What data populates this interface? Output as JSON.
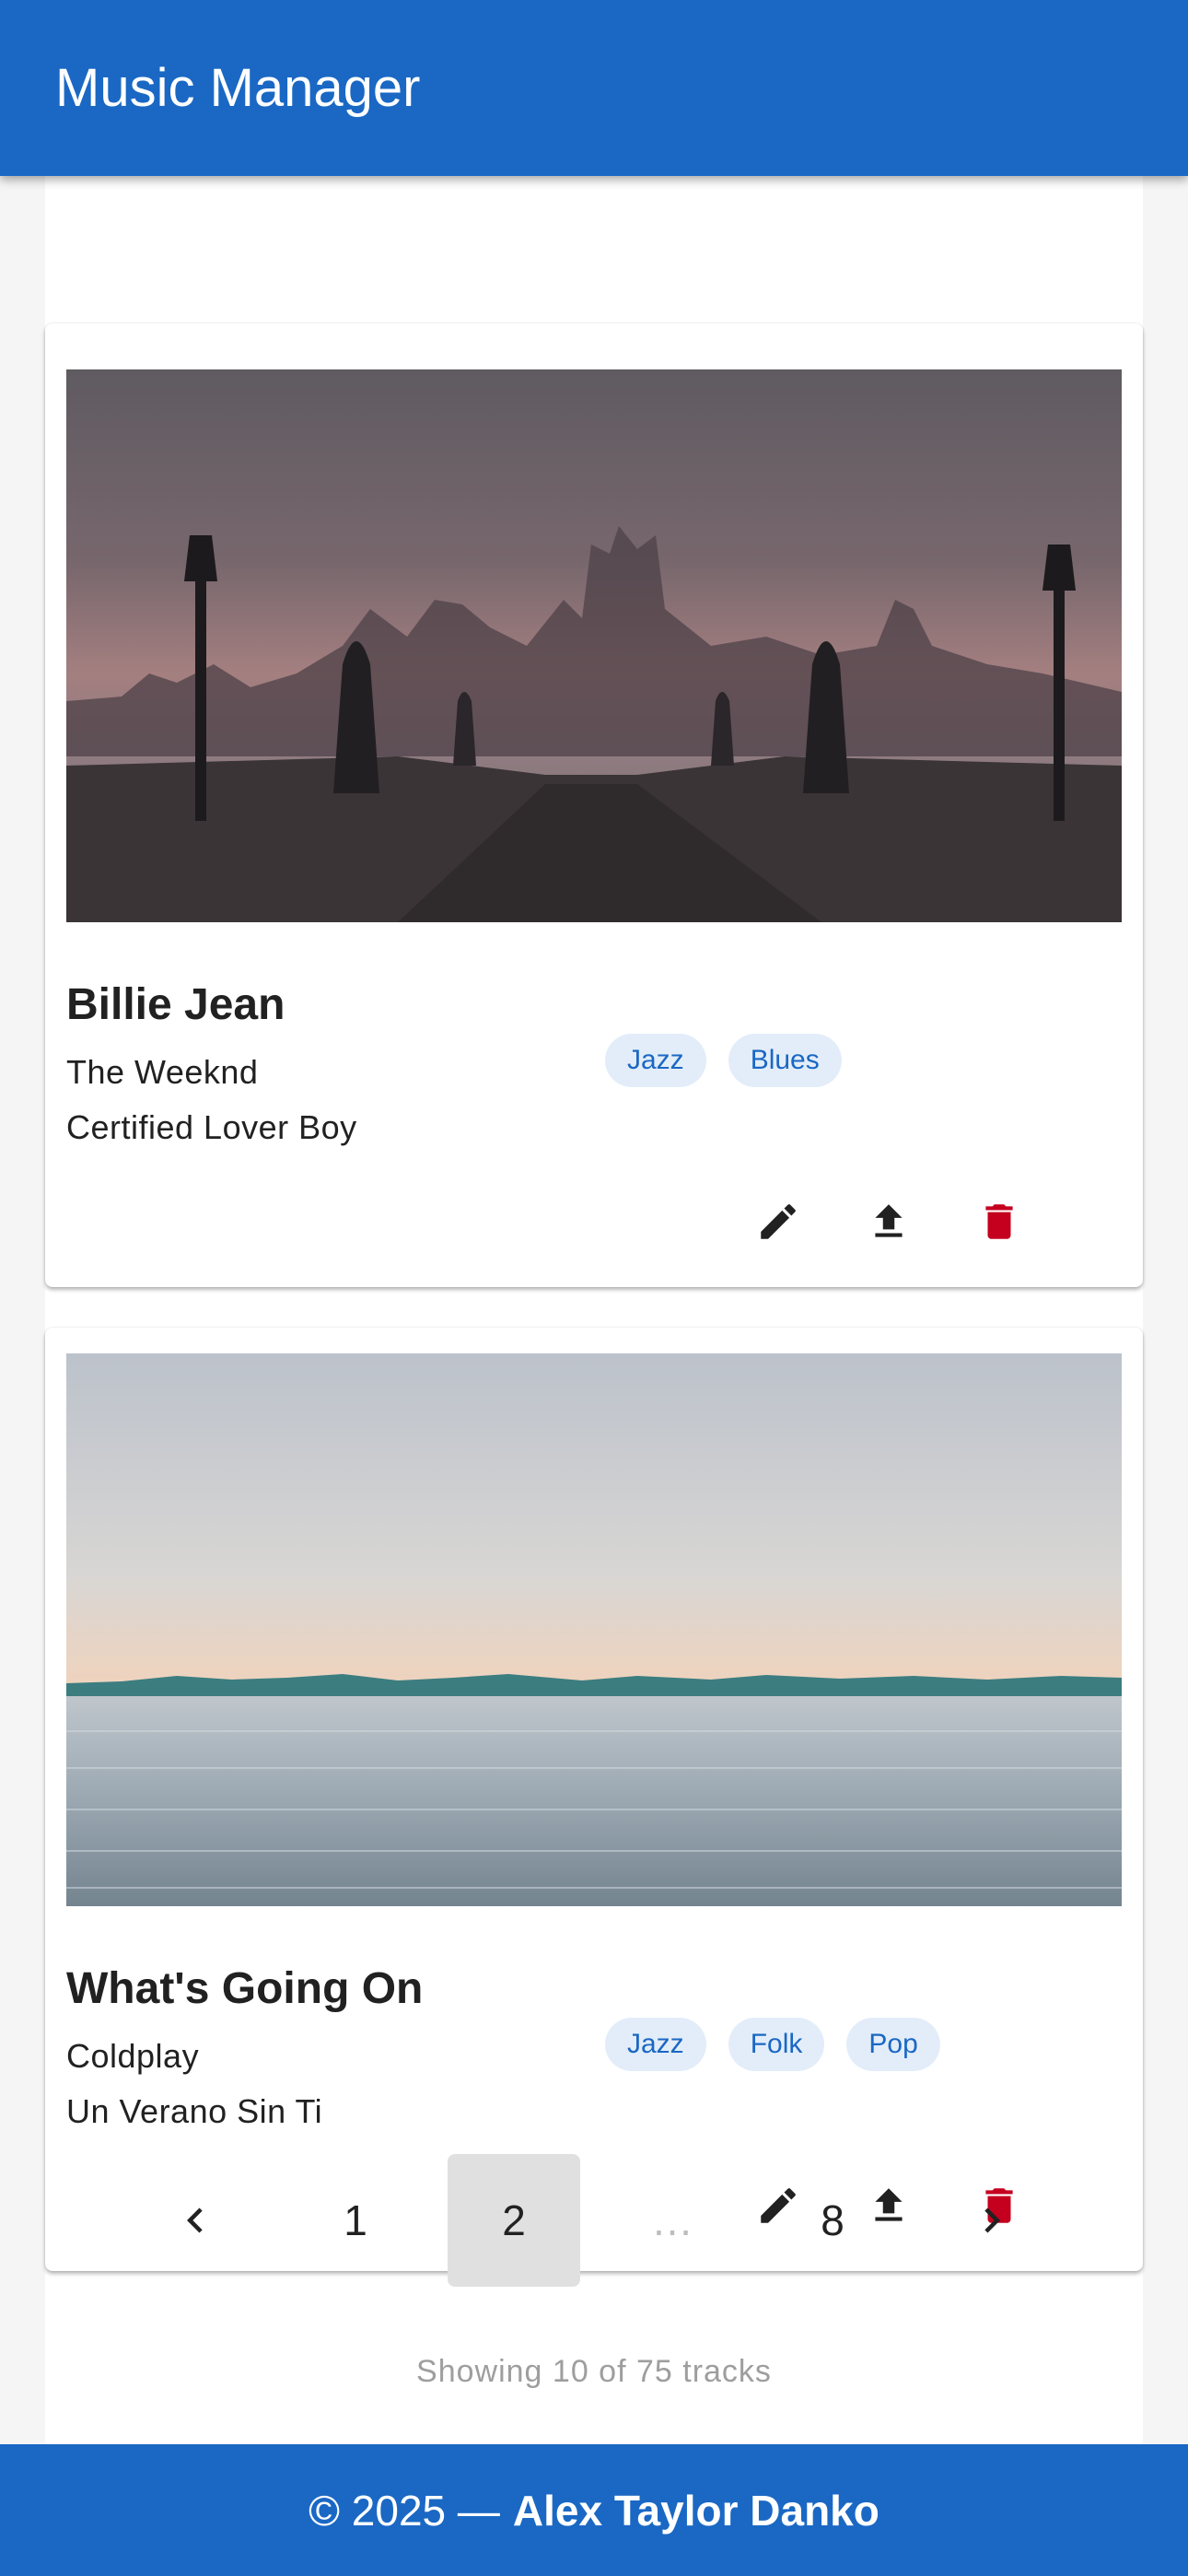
{
  "app": {
    "title": "Music Manager"
  },
  "colors": {
    "primary": "#1a68c4",
    "chip_bg": "#e3edf9",
    "delete": "#c5001f"
  },
  "tracks": [
    {
      "title": "Billie Jean",
      "artist": "The Weeknd",
      "album": "Certified Lover Boy",
      "genres": [
        "Jazz",
        "Blues"
      ],
      "cover": "bridge-statues-dusk-photo",
      "actions": [
        "edit-icon",
        "upload-icon",
        "delete-icon"
      ]
    },
    {
      "title": "What's Going On",
      "artist": "Coldplay",
      "album": "Un Verano Sin Ti",
      "genres": [
        "Jazz",
        "Folk",
        "Pop"
      ],
      "cover": "lake-sunset-photo",
      "actions": [
        "edit-icon",
        "upload-icon",
        "delete-icon"
      ]
    }
  ],
  "pagination": {
    "prev_icon": "chevron-left-icon",
    "next_icon": "chevron-right-icon",
    "pages": [
      "1",
      "2",
      "…",
      "8"
    ],
    "current": "2"
  },
  "status": {
    "count_text": "Showing 10 of 75 tracks"
  },
  "footer": {
    "prefix": "© 2025 —",
    "author": "Alex Taylor Danko"
  }
}
